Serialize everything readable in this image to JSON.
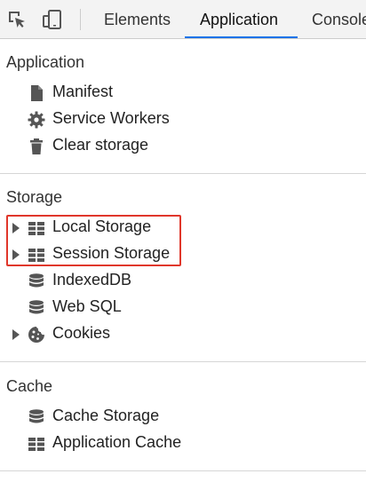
{
  "toolbar": {
    "inspect_icon": "inspect-element-icon",
    "device_icon": "device-toolbar-icon",
    "tabs": [
      {
        "label": "Elements",
        "active": false
      },
      {
        "label": "Application",
        "active": true
      },
      {
        "label": "Console",
        "active": false
      }
    ]
  },
  "sidebar": {
    "application": {
      "title": "Application",
      "items": [
        {
          "label": "Manifest",
          "icon": "document-icon"
        },
        {
          "label": "Service Workers",
          "icon": "gear-icon"
        },
        {
          "label": "Clear storage",
          "icon": "trash-icon"
        }
      ]
    },
    "storage": {
      "title": "Storage",
      "items": [
        {
          "label": "Local Storage",
          "icon": "grid-icon",
          "expandable": true
        },
        {
          "label": "Session Storage",
          "icon": "grid-icon",
          "expandable": true
        },
        {
          "label": "IndexedDB",
          "icon": "database-icon",
          "expandable": false
        },
        {
          "label": "Web SQL",
          "icon": "database-icon",
          "expandable": false
        },
        {
          "label": "Cookies",
          "icon": "cookie-icon",
          "expandable": true
        }
      ]
    },
    "cache": {
      "title": "Cache",
      "items": [
        {
          "label": "Cache Storage",
          "icon": "database-icon"
        },
        {
          "label": "Application Cache",
          "icon": "grid-icon"
        }
      ]
    }
  },
  "colors": {
    "accent": "#1a73e8",
    "highlight": "#e0372b",
    "icon": "#555555"
  }
}
